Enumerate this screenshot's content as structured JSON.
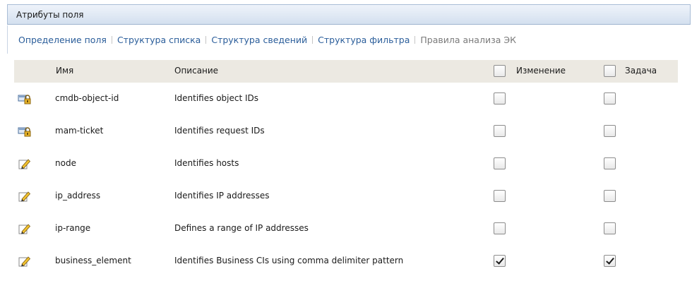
{
  "panel": {
    "title": "Атрибуты поля"
  },
  "tabs": [
    {
      "label": "Определение поля",
      "disabled": false
    },
    {
      "label": "Структура списка",
      "disabled": false
    },
    {
      "label": "Структура сведений",
      "disabled": false
    },
    {
      "label": "Структура фильтра",
      "disabled": false
    },
    {
      "label": "Правила анализа ЭК",
      "disabled": true
    }
  ],
  "grid": {
    "columns": {
      "name": "Имя",
      "description": "Описание",
      "change": "Изменение",
      "task": "Задача"
    },
    "rows": [
      {
        "icon": "locked-field-icon",
        "name": "cmdb-object-id",
        "description": "Identifies object IDs",
        "change": false,
        "task": false
      },
      {
        "icon": "locked-field-icon",
        "name": "mam-ticket",
        "description": "Identifies request IDs",
        "change": false,
        "task": false
      },
      {
        "icon": "edit-field-icon",
        "name": "node",
        "description": "Identifies hosts",
        "change": false,
        "task": false
      },
      {
        "icon": "edit-field-icon",
        "name": "ip_address",
        "description": "Identifies IP addresses",
        "change": false,
        "task": false
      },
      {
        "icon": "edit-field-icon",
        "name": "ip-range",
        "description": "Defines a range of IP addresses",
        "change": false,
        "task": false
      },
      {
        "icon": "edit-field-icon",
        "name": "business_element",
        "description": "Identifies Business CIs using comma delimiter pattern",
        "change": true,
        "task": true
      }
    ]
  }
}
